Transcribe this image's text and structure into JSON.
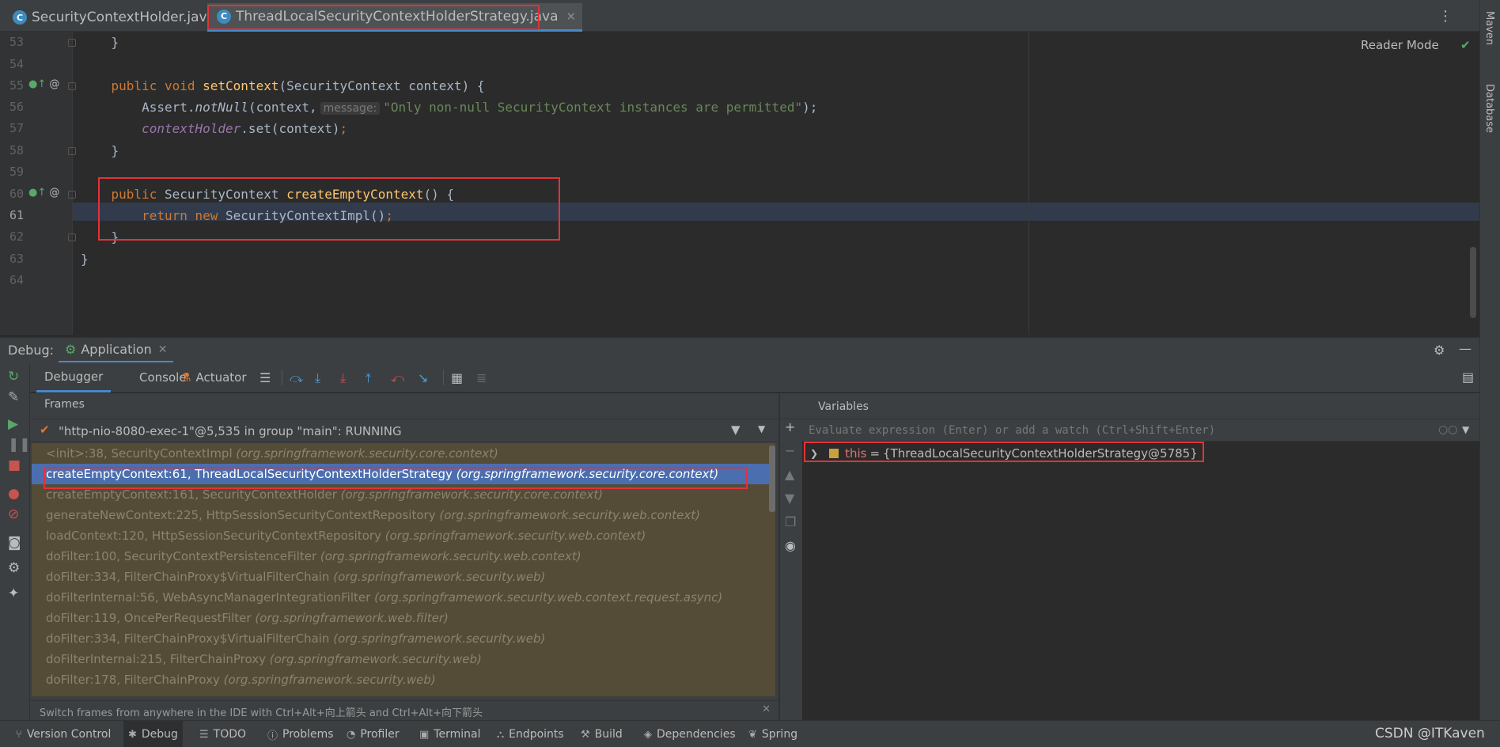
{
  "tabs": [
    {
      "label": "SecurityContextHolder.java",
      "icon": "java-class-icon"
    },
    {
      "label": "ThreadLocalSecurityContextHolderStrategy.java",
      "icon": "java-class-icon"
    }
  ],
  "right_stripe": {
    "maven": "Maven",
    "database": "Database"
  },
  "editor": {
    "reader_mode": "Reader Mode",
    "line_numbers": [
      "53",
      "54",
      "55",
      "56",
      "57",
      "58",
      "59",
      "60",
      "61",
      "62",
      "63",
      "64"
    ],
    "hint_message": "message:",
    "string_literal": "\"Only non-null SecurityContext instances are permitted\""
  },
  "debug": {
    "label": "Debug:",
    "app_tab": "Application",
    "tabs": {
      "debugger": "Debugger",
      "console": "Console",
      "actuator": "Actuator"
    }
  },
  "frames": {
    "title": "Frames",
    "thread": "\"http-nio-8080-exec-1\"@5,535 in group \"main\": RUNNING",
    "items": [
      {
        "method": "<init>:38, SecurityContextImpl",
        "pkg": "(org.springframework.security.core.context)"
      },
      {
        "method": "createEmptyContext:61, ThreadLocalSecurityContextHolderStrategy",
        "pkg": "(org.springframework.security.core.context)"
      },
      {
        "method": "createEmptyContext:161, SecurityContextHolder",
        "pkg": "(org.springframework.security.core.context)"
      },
      {
        "method": "generateNewContext:225, HttpSessionSecurityContextRepository",
        "pkg": "(org.springframework.security.web.context)"
      },
      {
        "method": "loadContext:120, HttpSessionSecurityContextRepository",
        "pkg": "(org.springframework.security.web.context)"
      },
      {
        "method": "doFilter:100, SecurityContextPersistenceFilter",
        "pkg": "(org.springframework.security.web.context)"
      },
      {
        "method": "doFilter:334, FilterChainProxy$VirtualFilterChain",
        "pkg": "(org.springframework.security.web)"
      },
      {
        "method": "doFilterInternal:56, WebAsyncManagerIntegrationFilter",
        "pkg": "(org.springframework.security.web.context.request.async)"
      },
      {
        "method": "doFilter:119, OncePerRequestFilter",
        "pkg": "(org.springframework.web.filter)"
      },
      {
        "method": "doFilter:334, FilterChainProxy$VirtualFilterChain",
        "pkg": "(org.springframework.security.web)"
      },
      {
        "method": "doFilterInternal:215, FilterChainProxy",
        "pkg": "(org.springframework.security.web)"
      },
      {
        "method": "doFilter:178, FilterChainProxy",
        "pkg": "(org.springframework.security.web)"
      }
    ],
    "tip": "Switch frames from anywhere in the IDE with Ctrl+Alt+向上箭头 and Ctrl+Alt+向下箭头"
  },
  "variables": {
    "title": "Variables",
    "eval_placeholder": "Evaluate expression (Enter) or add a watch (Ctrl+Shift+Enter)",
    "var_name": "this",
    "var_eq": "=",
    "var_value": "{ThreadLocalSecurityContextHolderStrategy@5785}"
  },
  "bottom_bar": {
    "items": [
      "Version Control",
      "Debug",
      "TODO",
      "Problems",
      "Profiler",
      "Terminal",
      "Endpoints",
      "Build",
      "Dependencies",
      "Spring"
    ]
  },
  "watermark": "CSDN @ITKaven",
  "colors": {
    "highlight_box": "#e0333a",
    "selection": "#4b6eaf",
    "frames_bg": "#544c36"
  }
}
